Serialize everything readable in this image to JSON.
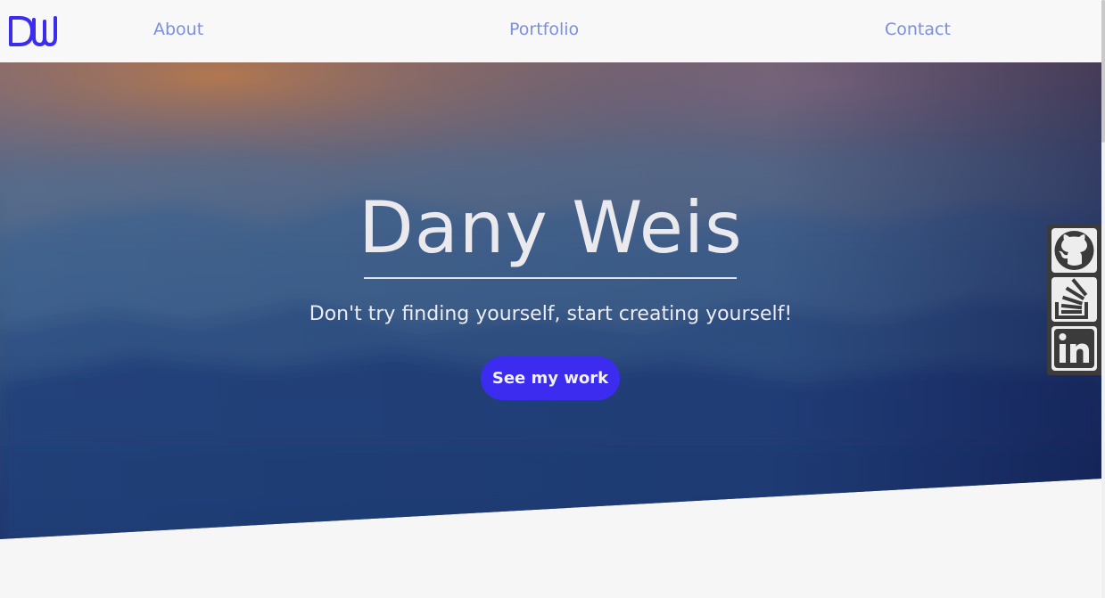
{
  "nav": {
    "logo_text": "DW",
    "links": [
      {
        "label": "About"
      },
      {
        "label": "Portfolio"
      },
      {
        "label": "Contact"
      }
    ],
    "link_color": "#7b8fe0",
    "logo_color": "#3c2cf0"
  },
  "hero": {
    "title": "Dany Weis",
    "tagline": "Don't try finding yourself, start creating yourself!",
    "cta_label": "See my work",
    "cta_color": "#3c2cf0"
  },
  "social": {
    "items": [
      {
        "icon": "github-icon"
      },
      {
        "icon": "stackoverflow-icon"
      },
      {
        "icon": "linkedin-icon"
      }
    ]
  }
}
